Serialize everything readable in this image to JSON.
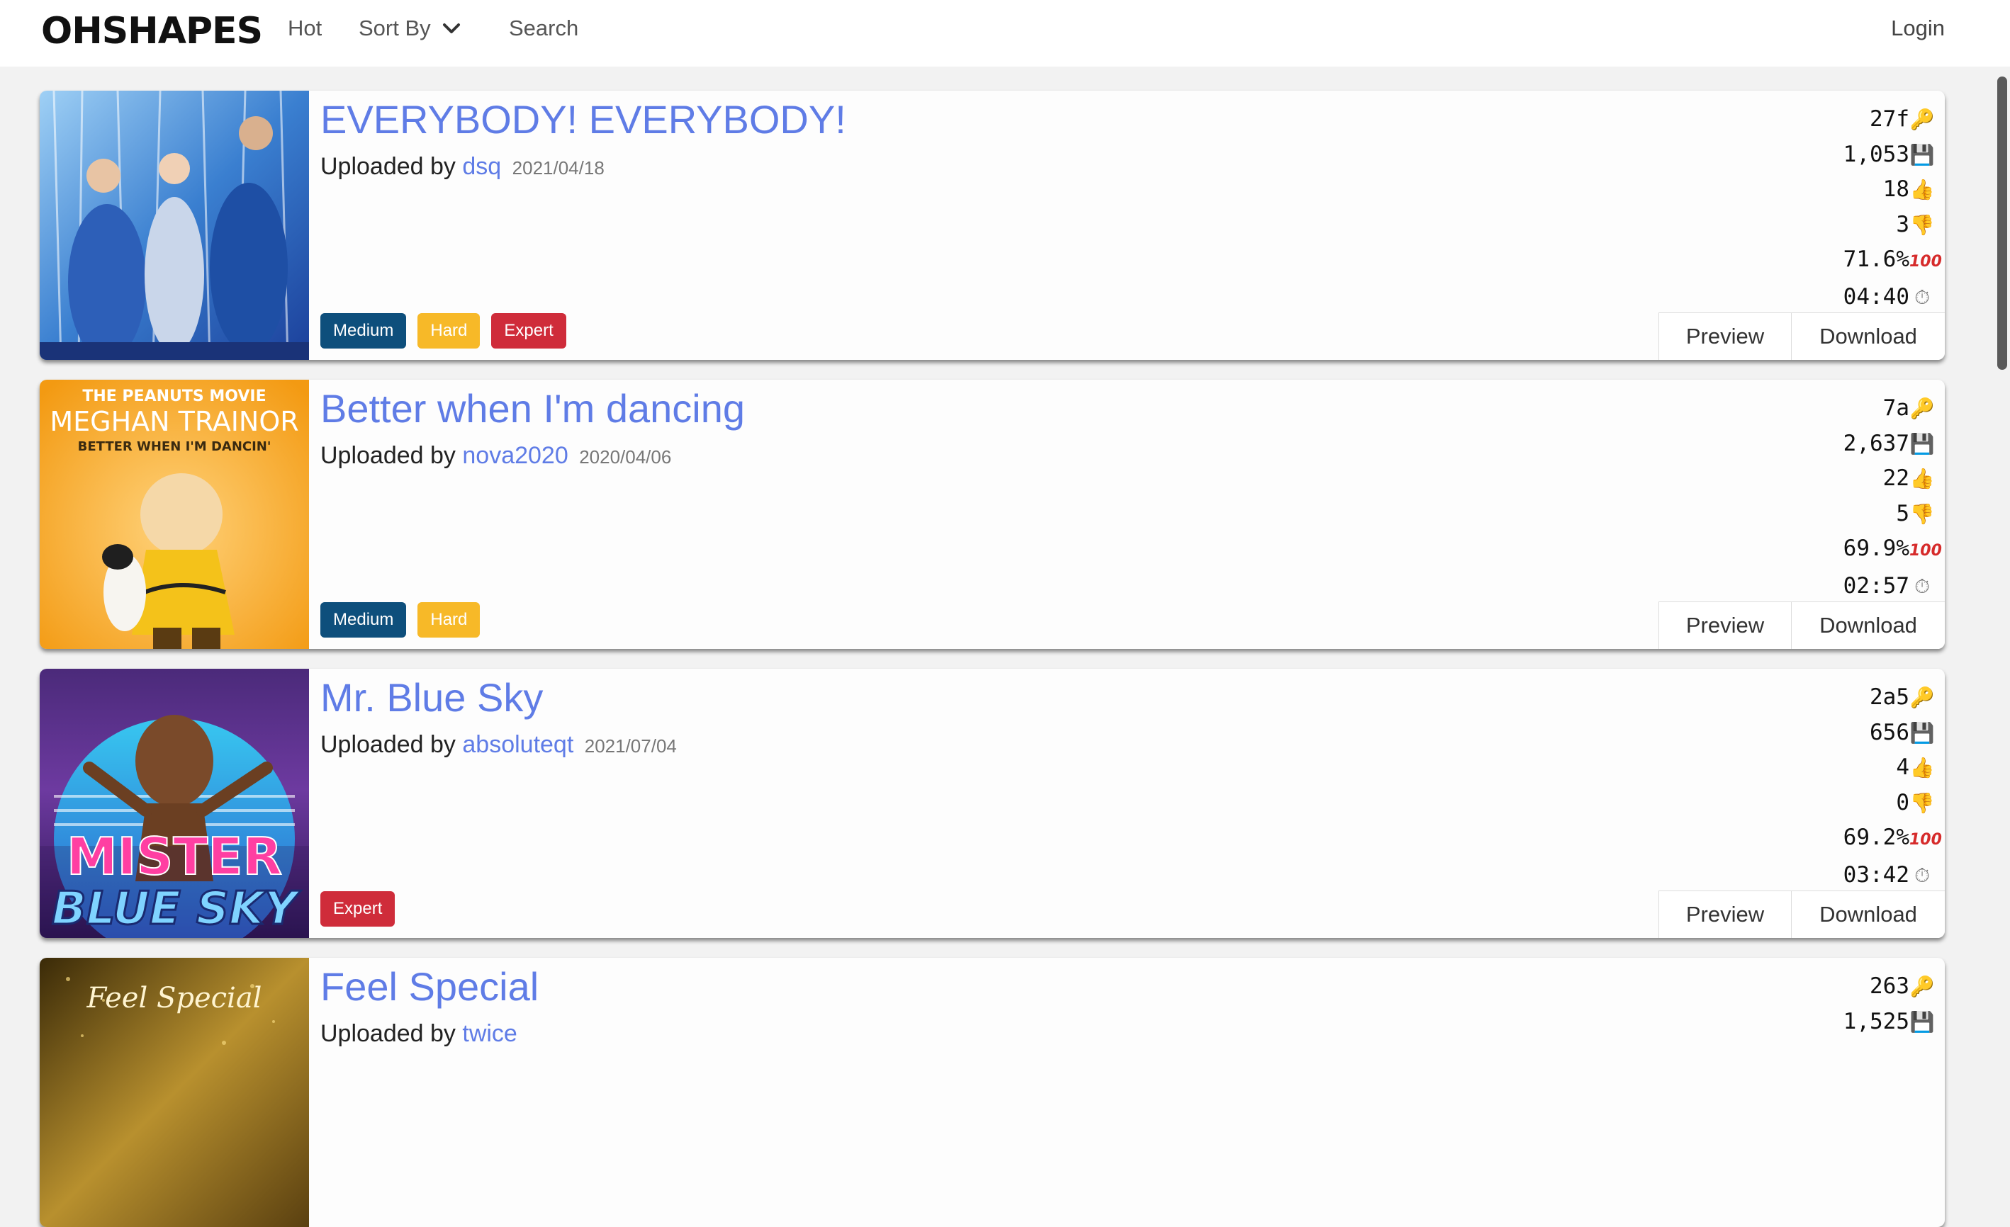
{
  "nav": {
    "brand": "OHSHAPES",
    "hot": "Hot",
    "sort_by": "Sort By",
    "search": "Search",
    "login": "Login"
  },
  "maps": [
    {
      "title": "EVERYBODY! EVERYBODY!",
      "uploaded_by_label": "Uploaded by",
      "user": "dsq",
      "date": "2021/04/18",
      "tags": [
        "Medium",
        "Hard",
        "Expert"
      ],
      "key": "27f",
      "downloads": "1,053",
      "upvotes": "18",
      "downvotes": "3",
      "rating": "71.6%",
      "duration": "04:40",
      "preview_label": "Preview",
      "download_label": "Download"
    },
    {
      "title": "Better when I'm dancing",
      "uploaded_by_label": "Uploaded by",
      "user": "nova2020",
      "date": "2020/04/06",
      "tags": [
        "Medium",
        "Hard"
      ],
      "key": "7a",
      "downloads": "2,637",
      "upvotes": "22",
      "downvotes": "5",
      "rating": "69.9%",
      "duration": "02:57",
      "preview_label": "Preview",
      "download_label": "Download",
      "art_text": [
        "THE PEANUTS MOVIE",
        "MEGHAN TRAINOR",
        "BETTER WHEN I'M DANCIN'"
      ]
    },
    {
      "title": "Mr. Blue Sky",
      "uploaded_by_label": "Uploaded by",
      "user": "absoluteqt",
      "date": "2021/07/04",
      "tags": [
        "Expert"
      ],
      "key": "2a5",
      "downloads": "656",
      "upvotes": "4",
      "downvotes": "0",
      "rating": "69.2%",
      "duration": "03:42",
      "preview_label": "Preview",
      "download_label": "Download",
      "art_text": [
        "MISTER",
        "BLUE SKY"
      ]
    },
    {
      "title": "Feel Special",
      "uploaded_by_label": "Uploaded by",
      "user": "twice",
      "date": "",
      "tags": [],
      "key": "263",
      "downloads": "1,525",
      "art_text": [
        "Feel Special"
      ]
    }
  ],
  "icons": {
    "key": "key-icon",
    "downloads": "floppy-disk-icon",
    "upvotes": "thumbs-up-icon",
    "downvotes": "thumbs-down-icon",
    "rating": "hundred-points-icon",
    "duration": "stopwatch-icon"
  },
  "colors": {
    "link": "#5f7ce6",
    "tag_medium": "#0e4f7c",
    "tag_hard": "#f7b928",
    "tag_expert": "#cf2c3a"
  }
}
